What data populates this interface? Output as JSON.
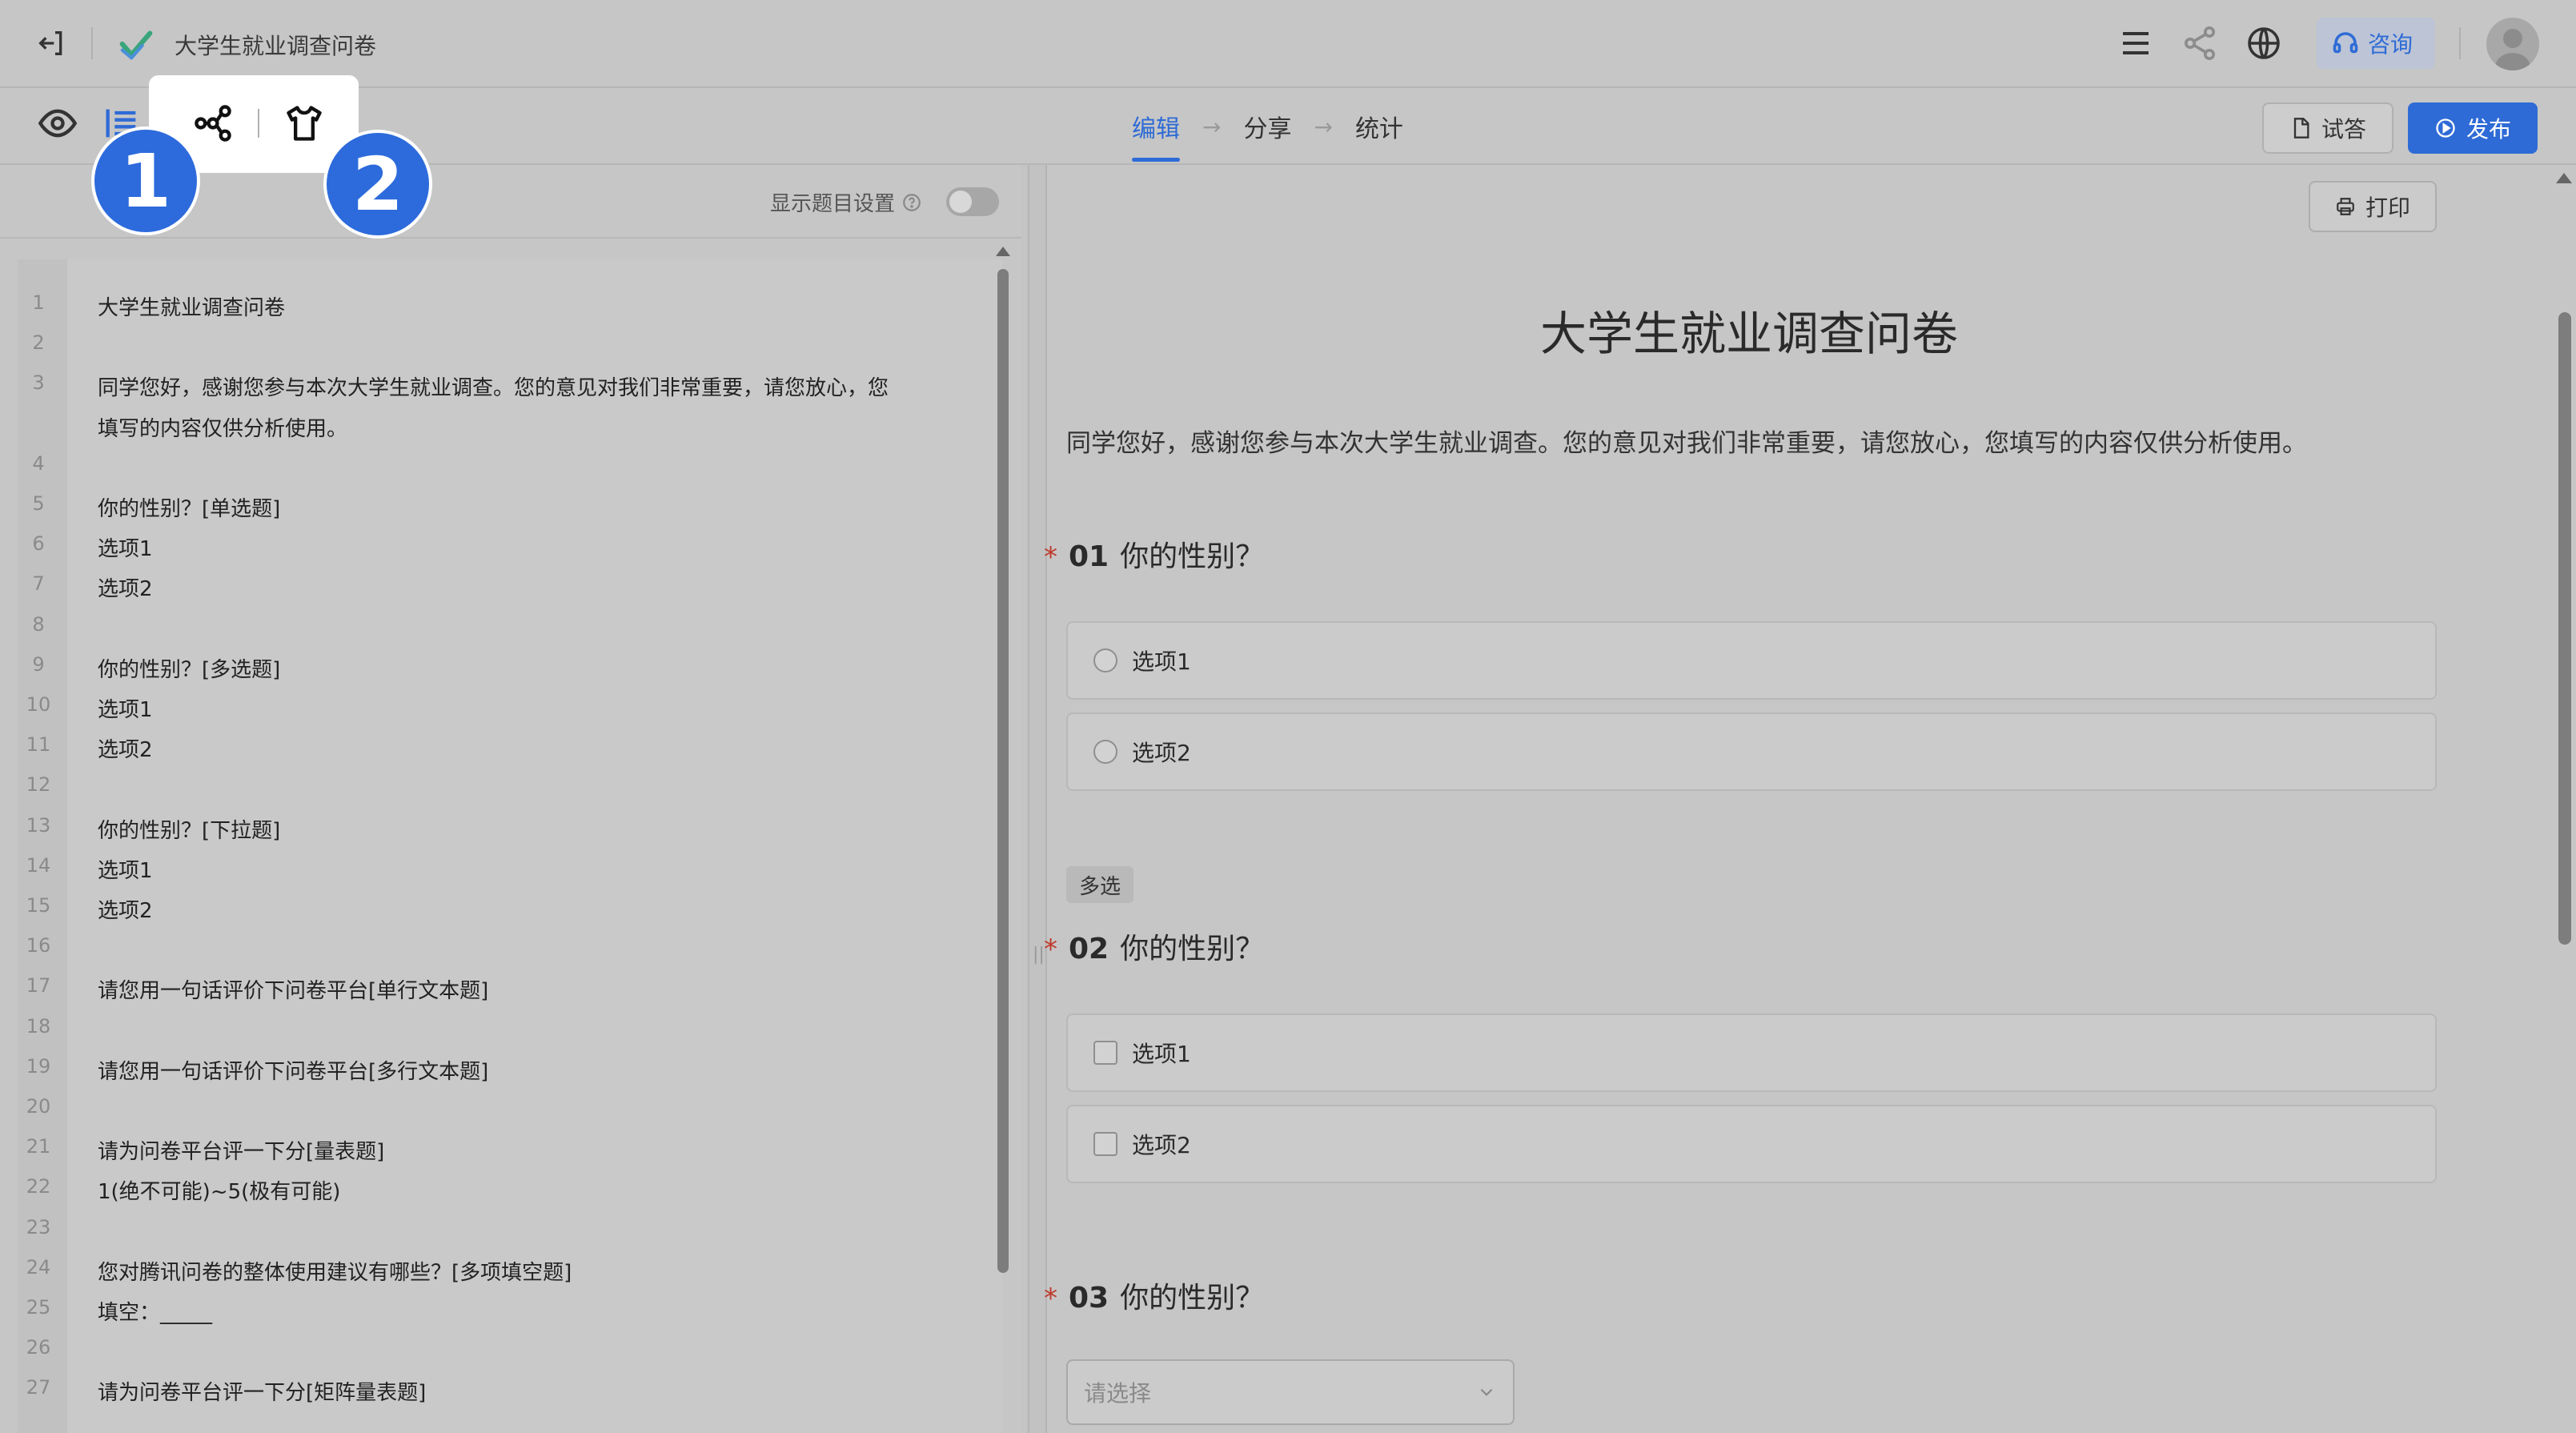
{
  "app": {
    "title": "大学生就业调查问卷",
    "consult_label": "咨询"
  },
  "subbar": {
    "steps": [
      "编辑",
      "分享",
      "统计"
    ],
    "active_step": "编辑",
    "trial_label": "试答",
    "publish_label": "发布",
    "badges": [
      "1",
      "2"
    ]
  },
  "editor": {
    "show_settings_label": "显示题目设置",
    "toggle_on": false,
    "lines": [
      {
        "n": "1",
        "text": "大学生就业调查问卷"
      },
      {
        "n": "2",
        "text": ""
      },
      {
        "n": "3",
        "text": "同学您好，感谢您参与本次大学生就业调查。您的意见对我们非常重要，请您放心，您"
      },
      {
        "n": "",
        "text": "填写的内容仅供分析使用。"
      },
      {
        "n": "4",
        "text": ""
      },
      {
        "n": "5",
        "text": "你的性别？[单选题]"
      },
      {
        "n": "6",
        "text": "选项1"
      },
      {
        "n": "7",
        "text": "选项2"
      },
      {
        "n": "8",
        "text": ""
      },
      {
        "n": "9",
        "text": "你的性别？[多选题]"
      },
      {
        "n": "10",
        "text": "选项1"
      },
      {
        "n": "11",
        "text": "选项2"
      },
      {
        "n": "12",
        "text": ""
      },
      {
        "n": "13",
        "text": "你的性别？[下拉题]"
      },
      {
        "n": "14",
        "text": "选项1"
      },
      {
        "n": "15",
        "text": "选项2"
      },
      {
        "n": "16",
        "text": ""
      },
      {
        "n": "17",
        "text": "请您用一句话评价下问卷平台[单行文本题]"
      },
      {
        "n": "18",
        "text": ""
      },
      {
        "n": "19",
        "text": "请您用一句话评价下问卷平台[多行文本题]"
      },
      {
        "n": "20",
        "text": ""
      },
      {
        "n": "21",
        "text": "请为问卷平台评一下分[量表题]"
      },
      {
        "n": "22",
        "text": "1(绝不可能)~5(极有可能)"
      },
      {
        "n": "23",
        "text": ""
      },
      {
        "n": "24",
        "text": "您对腾讯问卷的整体使用建议有哪些？[多项填空题]"
      },
      {
        "n": "25",
        "text": "填空：_____"
      },
      {
        "n": "26",
        "text": ""
      },
      {
        "n": "27",
        "text": "请为问卷平台评一下分[矩阵量表题]"
      }
    ]
  },
  "preview": {
    "print_label": "打印",
    "title": "大学生就业调查问卷",
    "intro": "同学您好，感谢您参与本次大学生就业调查。您的意见对我们非常重要，请您放心，您填写的内容仅供分析使用。",
    "questions": [
      {
        "required": "*",
        "number": "01",
        "text": "你的性别？",
        "type": "radio",
        "options": [
          "选项1",
          "选项2"
        ]
      },
      {
        "required": "*",
        "number": "02",
        "text": "你的性别？",
        "type": "checkbox",
        "tag": "多选",
        "options": [
          "选项1",
          "选项2"
        ]
      },
      {
        "required": "*",
        "number": "03",
        "text": "你的性别？",
        "type": "select",
        "placeholder": "请选择"
      }
    ]
  },
  "colors": {
    "accent": "#2e6bd6",
    "badge": "#2d6bdc",
    "required": "#c0392b"
  },
  "icons": [
    "exit-icon",
    "logo-icon",
    "menu-icon",
    "share-icon",
    "globe-icon",
    "headset-icon",
    "eye-icon",
    "outline-icon",
    "logic-icon",
    "theme-shirt-icon",
    "file-icon",
    "play-circle-icon",
    "print-icon",
    "help-icon",
    "chevron-down-icon"
  ]
}
